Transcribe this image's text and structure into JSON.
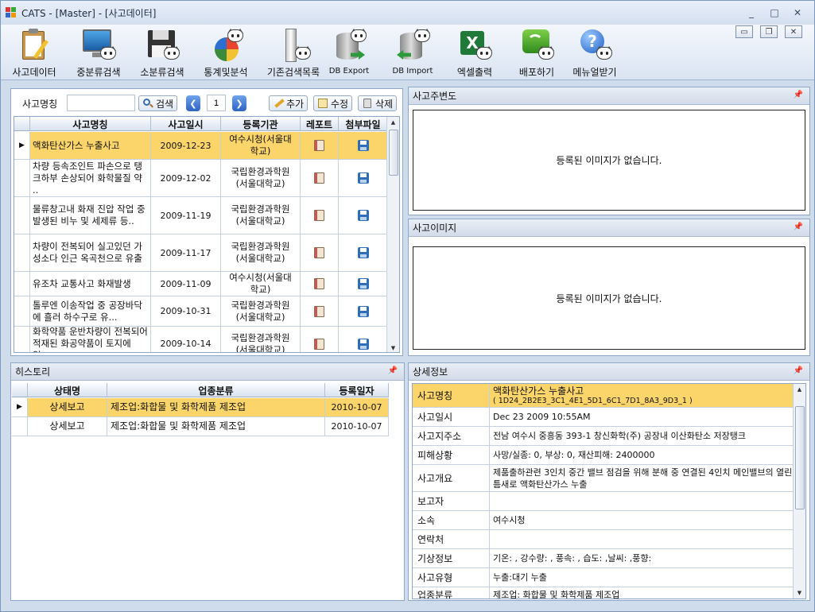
{
  "window": {
    "title": "CATS - [Master] - [사고데이터]",
    "controls": [
      "_",
      "□",
      "✕"
    ],
    "mdi_controls": [
      "▭",
      "❐",
      "✕"
    ]
  },
  "toolbar": {
    "items": [
      {
        "label": "사고데이터",
        "icon": "clipboard-icon"
      },
      {
        "label": "중분류검색",
        "icon": "monitor-cat-icon"
      },
      {
        "label": "소분류검색",
        "icon": "floppy-cat-icon"
      },
      {
        "label": "통계및분석",
        "icon": "pie-chart-cat-icon"
      },
      {
        "label": "기존검색목록",
        "icon": "cabinet-cat-icon"
      },
      {
        "label": "DB Export",
        "icon": "database-export-icon"
      },
      {
        "label": "DB Import",
        "icon": "database-import-icon"
      },
      {
        "label": "엑셀출력",
        "icon": "excel-icon"
      },
      {
        "label": "배포하기",
        "icon": "deploy-wifi-icon"
      },
      {
        "label": "메뉴얼받기",
        "icon": "help-icon"
      }
    ]
  },
  "search": {
    "label": "사고명칭",
    "input_value": "",
    "search_button": "검색",
    "page": "1",
    "add_button": "추가",
    "edit_button": "수정",
    "delete_button": "삭제"
  },
  "accident_grid": {
    "columns": [
      "사고명칭",
      "사고일시",
      "등록기관",
      "레포트",
      "첨부파일"
    ],
    "rows": [
      {
        "name": "액화탄산가스 누출사고",
        "date": "2009-12-23",
        "org": "여수시청(서울대학교)",
        "selected": true
      },
      {
        "name": "차량 등속조인트 파손으로 탱크하부 손상되어 화학물질 약 ..",
        "date": "2009-12-02",
        "org": "국립환경과학원(서울대학교)"
      },
      {
        "name": "물류창고내 화재 진압 작업 중 발생된 비누 및 세제류 등..",
        "date": "2009-11-19",
        "org": "국립환경과학원(서울대학교)"
      },
      {
        "name": "차량이 전복되어 실고있던 가성소다 인근 옥곡천으로 유출",
        "date": "2009-11-17",
        "org": "국립환경과학원(서울대학교)"
      },
      {
        "name": "유조차 교통사고 화재발생",
        "date": "2009-11-09",
        "org": "여수시청(서울대학교)"
      },
      {
        "name": "톨루엔 이송작업 중 공장바닥에 흘러 하수구로 유...",
        "date": "2009-10-31",
        "org": "국립환경과학원(서울대학교)"
      },
      {
        "name": "화학약품 운반차량이 전복되어 적재된 화공약품이 토지에 일..",
        "date": "2009-10-14",
        "org": "국립환경과학원(서울대학교)"
      }
    ]
  },
  "panels": {
    "surroundings": {
      "title": "사고주변도",
      "empty_text": "등록된 이미지가 없습니다."
    },
    "images": {
      "title": "사고이미지",
      "empty_text": "등록된 이미지가 없습니다."
    },
    "history": {
      "title": "히스토리"
    },
    "detail": {
      "title": "상세정보"
    }
  },
  "history_grid": {
    "columns": [
      "상태명",
      "업종분류",
      "등록일자"
    ],
    "rows": [
      {
        "status": "상세보고",
        "category": "제조업:화합물 및 화학제품 제조업",
        "date": "2010-10-07",
        "selected": true
      },
      {
        "status": "상세보고",
        "category": "제조업:화합물 및 화학제품 제조업",
        "date": "2010-10-07"
      }
    ]
  },
  "detail": {
    "rows": [
      {
        "label": "사고명칭",
        "value": "액화탄산가스 누출사고",
        "value2": "( 1D24_2B2E3_3C1_4E1_5D1_6C1_7D1_8A3_9D3_1                    )"
      },
      {
        "label": "사고일시",
        "value": "Dec 23 2009 10:55AM"
      },
      {
        "label": "사고지주소",
        "value": "전남 여수시 중흥동 393-1 창신화학(주) 공장내 이산화탄소 저장탱크"
      },
      {
        "label": "피해상황",
        "value": "사망/실종: 0, 부상: 0, 재산피해: 2400000"
      },
      {
        "label": "사고개요",
        "value": "제품출하관련 3인치 중간 밸브 점검을 위해 분해 중 연결된 4인치 메인밸브의 열린틈새로 액화탄산가스 누출"
      },
      {
        "label": "보고자",
        "value": ""
      },
      {
        "label": "소속",
        "value": "여수시청"
      },
      {
        "label": "연락처",
        "value": ""
      },
      {
        "label": "기상정보",
        "value": "기온: ,  강수량: ,  풍속: ,  습도:  ,날씨:   ,풍향:"
      },
      {
        "label": "사고유형",
        "value": "누출:대기 누출"
      },
      {
        "label": "업종분류",
        "value": "제조업: 화합물 및 화학제품 제조업"
      }
    ]
  }
}
